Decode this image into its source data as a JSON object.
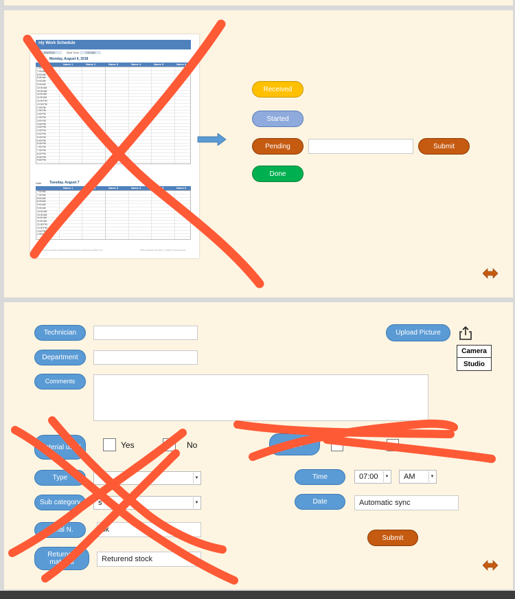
{
  "top_panel": {
    "schedule_thumbnail": {
      "title": "nly Work Schedule",
      "day1": "Monday, August 6, 2018",
      "day2": "Tuesday, August 7",
      "date_label": "Date",
      "start_time_label": "Start Time",
      "start_time_value": "7:00 AM",
      "date_value": "8/6/2018",
      "columns": [
        "Name 1",
        "Name 2",
        "Name 3",
        "Name 4",
        "Name 5",
        "Name 6"
      ],
      "times": [
        "7:00 AM",
        "7:30 AM",
        "8:00 AM",
        "8:30 AM",
        "9:00 AM",
        "9:30 AM",
        "10:00 AM",
        "10:30 AM",
        "11:00 AM",
        "11:30 AM",
        "12:00 PM",
        "12:30 PM",
        "1:00 PM",
        "1:30 PM",
        "2:00 PM",
        "2:30 PM",
        "3:00 PM",
        "3:30 PM",
        "4:00 PM",
        "4:30 PM",
        "5:00 PM",
        "5:30 PM",
        "6:00 PM",
        "6:30 PM",
        "7:00 PM",
        "7:30 PM",
        "8:00 PM",
        "8:30 PM",
        "9:00 PM"
      ],
      "times2": [
        "7:00 AM",
        "7:30 AM",
        "8:00 AM",
        "8:30 AM",
        "9:00 AM",
        "9:30 AM",
        "10:00 AM",
        "10:30 AM",
        "11:00 AM",
        "11:30 AM",
        "12:00 PM",
        "12:30 PM",
        "1:00 PM",
        "1:30 PM"
      ],
      "footer_left": "https://www.vertex42.com/ExcelTemplates/work-schedule-template.html",
      "footer_right": "Work Schedule Template © 2018 by Vertex42.com"
    },
    "status_buttons": {
      "received": "Received",
      "started": "Started",
      "pending": "Pending",
      "done": "Done"
    },
    "pending_input_value": "",
    "submit_label": "Submit",
    "colors": {
      "received": "#ffc000",
      "started": "#8faadc",
      "pending": "#c55a11",
      "done": "#00b050",
      "cross": "#ff5a36"
    }
  },
  "bottom_panel": {
    "technician_label": "Technician",
    "technician_value": "",
    "department_label": "Department",
    "department_value": "",
    "comments_label": "Comments",
    "comments_value": "",
    "upload_label": "Upload Picture",
    "upload_menu": [
      "Camera",
      "Studio"
    ],
    "material_used_label": "Material used",
    "yes_label": "Yes",
    "no_label": "No",
    "type_label": "Type",
    "type_value": "",
    "sub_category_label": "Sub category",
    "sub_category_value": "s",
    "serial_label": "Serial N.",
    "serial_value": "ck",
    "returned_label": "Returned material",
    "returned_value": "Returend stock",
    "right_type_label": "Type",
    "time_label": "Time",
    "time_hour": "07:00",
    "time_ampm": "AM",
    "date_label": "Date",
    "date_value": "Automatic sync",
    "submit_label": "Submit"
  },
  "icons": [
    "arrow-right-icon",
    "resize-horizontal-icon",
    "share-upload-icon"
  ]
}
